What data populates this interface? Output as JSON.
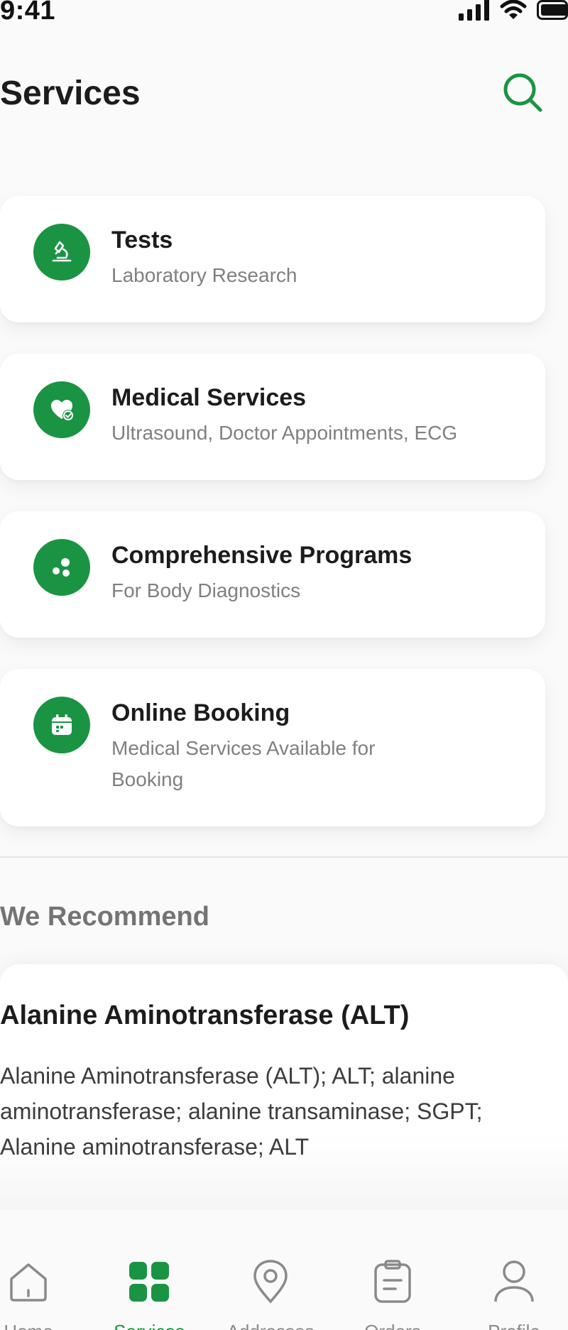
{
  "status_bar": {
    "time": "9:41"
  },
  "header": {
    "title": "Services"
  },
  "services": [
    {
      "title": "Tests",
      "subtitle": "Laboratory Research",
      "icon": "microscope-icon"
    },
    {
      "title": "Medical Services",
      "subtitle": "Ultrasound, Doctor Appointments, ECG",
      "icon": "heart-icon"
    },
    {
      "title": "Comprehensive Programs",
      "subtitle": "For Body Diagnostics",
      "icon": "dots-icon"
    },
    {
      "title": "Online Booking",
      "subtitle": "Medical Services Available for Booking",
      "icon": "calendar-icon"
    }
  ],
  "recommend": {
    "heading": "We Recommend",
    "item": {
      "title": "Alanine Aminotransferase (ALT)",
      "description": "Alanine Aminotransferase (ALT); ALT; alanine aminotransferase; alanine transaminase; SGPT; Alanine aminotransferase; ALT"
    }
  },
  "tabs": [
    {
      "label": "Home",
      "icon": "home-icon",
      "active": false
    },
    {
      "label": "Services",
      "icon": "grid-icon",
      "active": true
    },
    {
      "label": "Addresses",
      "icon": "location-pin-icon",
      "active": false
    },
    {
      "label": "Orders",
      "icon": "clipboard-icon",
      "active": false
    },
    {
      "label": "Profile",
      "icon": "user-icon",
      "active": false
    }
  ],
  "colors": {
    "accent": "#1a9443",
    "inactive": "#8a8a8a",
    "background": "#fafafa"
  }
}
